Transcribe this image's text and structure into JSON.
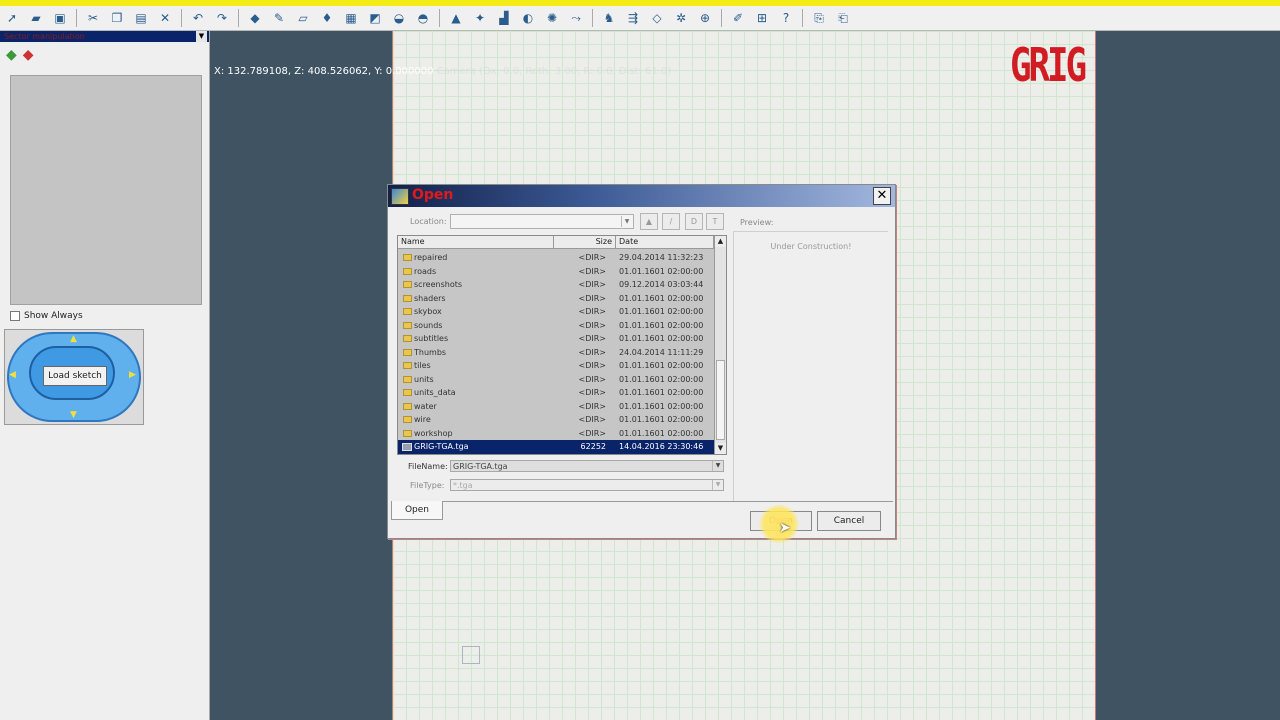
{
  "coords_text": "X: 132.789108, Z: 408.526062, Y: 0.000000",
  "coords_faded": "Camera (Dx: 0.0, Roth: 3.00, R: 0.0, Dist: 61.0)",
  "sidebar": {
    "header_title": "Sector manipulation",
    "show_always_label": "Show Always",
    "load_sketch_label": "Load sketch"
  },
  "logo_text": "GRIG",
  "dialog": {
    "title": "Open",
    "location_label": "Location:",
    "preview_label": "Preview:",
    "preview_text": "Under Construction!",
    "columns": {
      "name": "Name",
      "size": "Size",
      "date": "Date"
    },
    "files": [
      {
        "name": "repaired",
        "size": "<DIR>",
        "date": "29.04.2014 11:32:23"
      },
      {
        "name": "roads",
        "size": "<DIR>",
        "date": "01.01.1601 02:00:00"
      },
      {
        "name": "screenshots",
        "size": "<DIR>",
        "date": "09.12.2014 03:03:44"
      },
      {
        "name": "shaders",
        "size": "<DIR>",
        "date": "01.01.1601 02:00:00"
      },
      {
        "name": "skybox",
        "size": "<DIR>",
        "date": "01.01.1601 02:00:00"
      },
      {
        "name": "sounds",
        "size": "<DIR>",
        "date": "01.01.1601 02:00:00"
      },
      {
        "name": "subtitles",
        "size": "<DIR>",
        "date": "01.01.1601 02:00:00"
      },
      {
        "name": "Thumbs",
        "size": "<DIR>",
        "date": "24.04.2014 11:11:29"
      },
      {
        "name": "tiles",
        "size": "<DIR>",
        "date": "01.01.1601 02:00:00"
      },
      {
        "name": "units",
        "size": "<DIR>",
        "date": "01.01.1601 02:00:00"
      },
      {
        "name": "units_data",
        "size": "<DIR>",
        "date": "01.01.1601 02:00:00"
      },
      {
        "name": "water",
        "size": "<DIR>",
        "date": "01.01.1601 02:00:00"
      },
      {
        "name": "wire",
        "size": "<DIR>",
        "date": "01.01.1601 02:00:00"
      },
      {
        "name": "workshop",
        "size": "<DIR>",
        "date": "01.01.1601 02:00:00"
      },
      {
        "name": "GRIG-TGA.tga",
        "size": "62252",
        "date": "14.04.2016 23:30:46"
      }
    ],
    "filename_label": "FileName:",
    "filename_value": "GRIG-TGA.tga",
    "filetype_label": "FileType:",
    "filetype_value": "*.tga",
    "tab_open_label": "Open",
    "open_button_label": "Open",
    "cancel_button_label": "Cancel"
  },
  "colors": {
    "logo": "#d21c24",
    "title_text": "#e21919",
    "selection": "#0a246a",
    "yellow_strip": "#f5ec17"
  }
}
